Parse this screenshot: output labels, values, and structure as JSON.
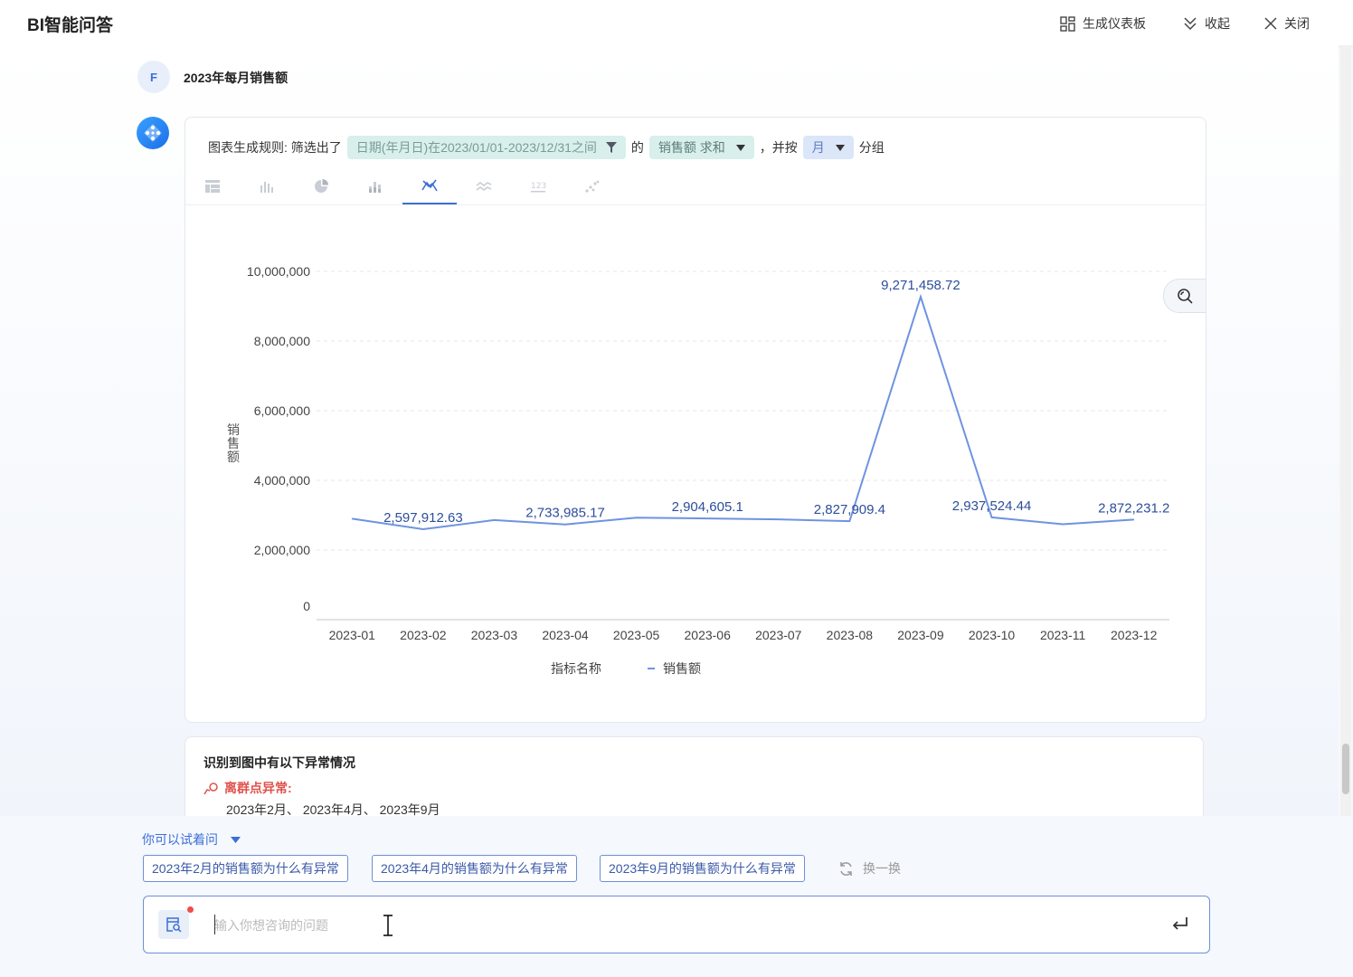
{
  "app": {
    "title": "BI智能问答"
  },
  "header": {
    "dashboard_label": "生成仪表板",
    "collapse_label": "收起",
    "close_label": "关闭"
  },
  "conversation": {
    "user_avatar": "F",
    "question": "2023年每月销售额",
    "rule": {
      "prefix": "图表生成规则: 筛选出了",
      "filter": "日期(年月日)在2023/01/01-2023/12/31之间",
      "of": "的",
      "measure": "销售额 求和",
      "group_by_prefix": "，并按",
      "group": "月",
      "group_suffix": "分组"
    },
    "chart_tabs": [
      "table-icon",
      "bar-chart-icon",
      "pie-chart-icon",
      "stacked-bar-icon",
      "line-chart-icon",
      "area-chart-icon",
      "kpi-number-icon",
      "scatter-icon"
    ],
    "active_tab": 4,
    "chart_data": {
      "type": "line",
      "categories": [
        "2023-01",
        "2023-02",
        "2023-03",
        "2023-04",
        "2023-05",
        "2023-06",
        "2023-07",
        "2023-08",
        "2023-09",
        "2023-10",
        "2023-11",
        "2023-12"
      ],
      "series": [
        {
          "name": "销售额",
          "values": [
            2900000,
            2597912.63,
            2860000,
            2733985.17,
            2930000,
            2904605.1,
            2880000,
            2827909.4,
            9271458.72,
            2937524.44,
            2740000,
            2872231.2
          ]
        }
      ],
      "labels": {
        "1": "2,597,912.63",
        "3": "2,733,985.17",
        "5": "2,904,605.1",
        "7": "2,827,909.4",
        "8": "9,271,458.72",
        "9": "2,937,524.44",
        "11": "2,872,231.2"
      },
      "y_ticks": [
        0,
        2000000,
        4000000,
        6000000,
        8000000,
        10000000
      ],
      "y_tick_labels": [
        "0",
        "2,000,000",
        "4,000,000",
        "6,000,000",
        "8,000,000",
        "10,000,000"
      ],
      "ylim": [
        0,
        10000000
      ],
      "ylabel": "销售额",
      "legend_title": "指标名称",
      "legend_position": "bottom",
      "grid": true,
      "line_color": "#6f93e0"
    },
    "anomaly": {
      "title": "识别到图中有以下异常情况",
      "type": "离群点异常:",
      "items": "2023年2月、 2023年4月、 2023年9月"
    }
  },
  "suggestions": {
    "label": "你可以试着问",
    "items": [
      "2023年2月的销售额为什么有异常",
      "2023年4月的销售额为什么有异常",
      "2023年9月的销售额为什么有异常"
    ],
    "refresh_label": "换一换"
  },
  "input": {
    "placeholder": "输入你想咨询的问题"
  }
}
